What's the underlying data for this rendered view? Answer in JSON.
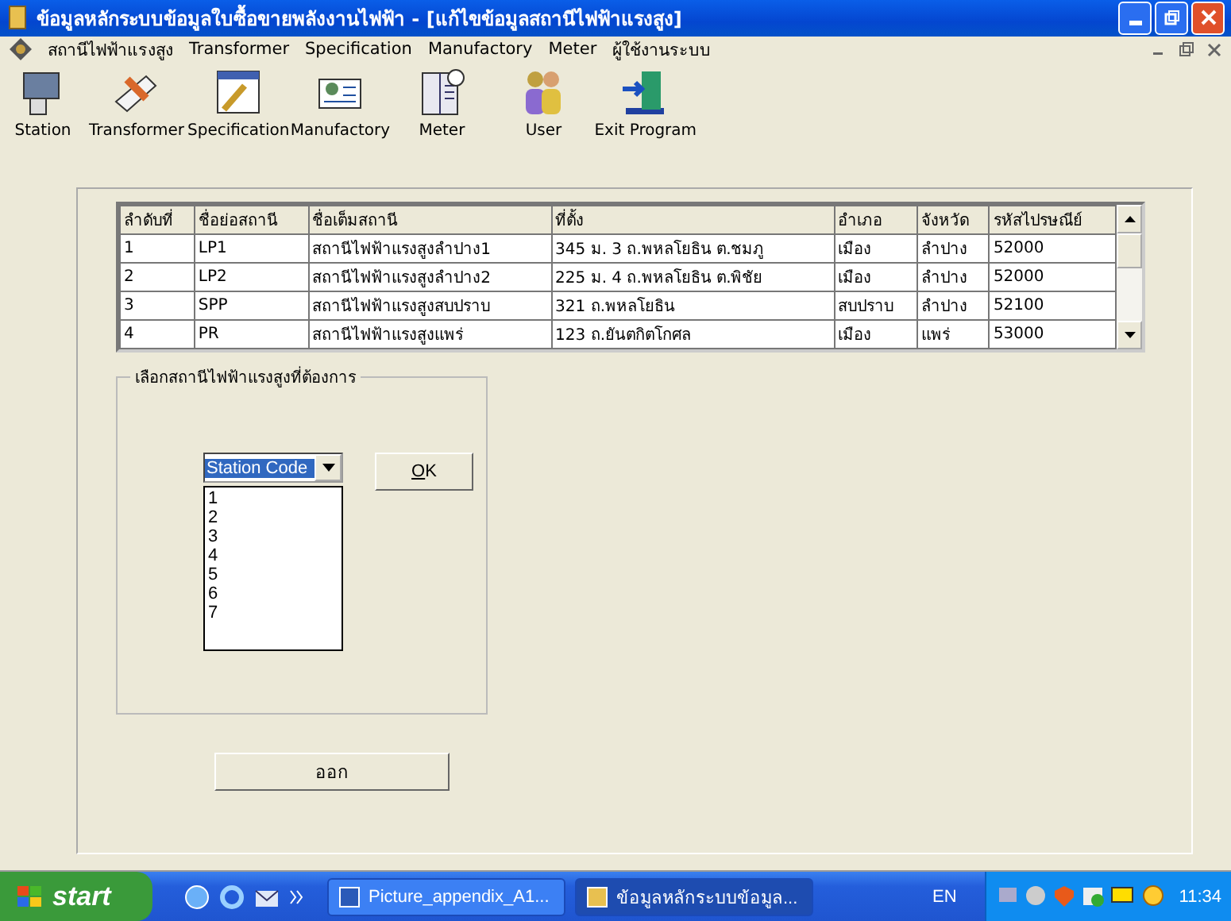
{
  "window": {
    "title": "ข้อมูลหลักระบบข้อมูลใบซื้อขายพลังงานไฟฟ้า - [แก้ไขข้อมูลสถานีไฟฟ้าแรงสูง]"
  },
  "menu": [
    "สถานีไฟฟ้าแรงสูง",
    "Transformer",
    "Specification",
    "Manufactory",
    "Meter",
    "ผู้ใช้งานระบบ"
  ],
  "toolbar": [
    {
      "label": "Station",
      "kind": "station"
    },
    {
      "label": "Transformer",
      "kind": "transformer"
    },
    {
      "label": "Specification",
      "kind": "specification"
    },
    {
      "label": "Manufactory",
      "kind": "manufactory"
    },
    {
      "label": "Meter",
      "kind": "meter"
    },
    {
      "label": "User",
      "kind": "user"
    },
    {
      "label": "Exit Program",
      "kind": "exit"
    }
  ],
  "table": {
    "columns": [
      "ลำดับที่",
      "ชื่อย่อสถานี",
      "ชื่อเต็มสถานี",
      "ที่ตั้ง",
      "อำเภอ",
      "จังหวัด",
      "รหัสไปรษณีย์"
    ],
    "rows": [
      [
        "1",
        "LP1",
        "สถานีไฟฟ้าแรงสูงลำปาง1",
        "345 ม. 3 ถ.พหลโยธิน ต.ชมภู",
        "เมือง",
        "ลำปาง",
        "52000"
      ],
      [
        "2",
        "LP2",
        "สถานีไฟฟ้าแรงสูงลำปาง2",
        "225 ม. 4 ถ.พหลโยธิน ต.พิชัย",
        "เมือง",
        "ลำปาง",
        "52000"
      ],
      [
        "3",
        "SPP",
        "สถานีไฟฟ้าแรงสูงสบปราบ",
        "321 ถ.พหลโยธิน",
        "สบปราบ",
        "ลำปาง",
        "52100"
      ],
      [
        "4",
        "PR",
        "สถานีไฟฟ้าแรงสูงแพร่",
        "123 ถ.ยันตกิตโกศล",
        "เมือง",
        "แพร่",
        "53000"
      ]
    ]
  },
  "group": {
    "label": "เลือกสถานีไฟฟ้าแรงสูงที่ต้องการ",
    "combo_value": "Station Code",
    "options": [
      "1",
      "2",
      "3",
      "4",
      "5",
      "6",
      "7"
    ],
    "ok_button": "OK"
  },
  "exit_button": "ออก",
  "taskbar": {
    "start": "start",
    "tasks": [
      {
        "label": "Picture_appendix_A1...",
        "selected": false
      },
      {
        "label": "ข้อมูลหลักระบบข้อมูล...",
        "selected": true
      }
    ],
    "language": "EN",
    "time": "11:34"
  }
}
